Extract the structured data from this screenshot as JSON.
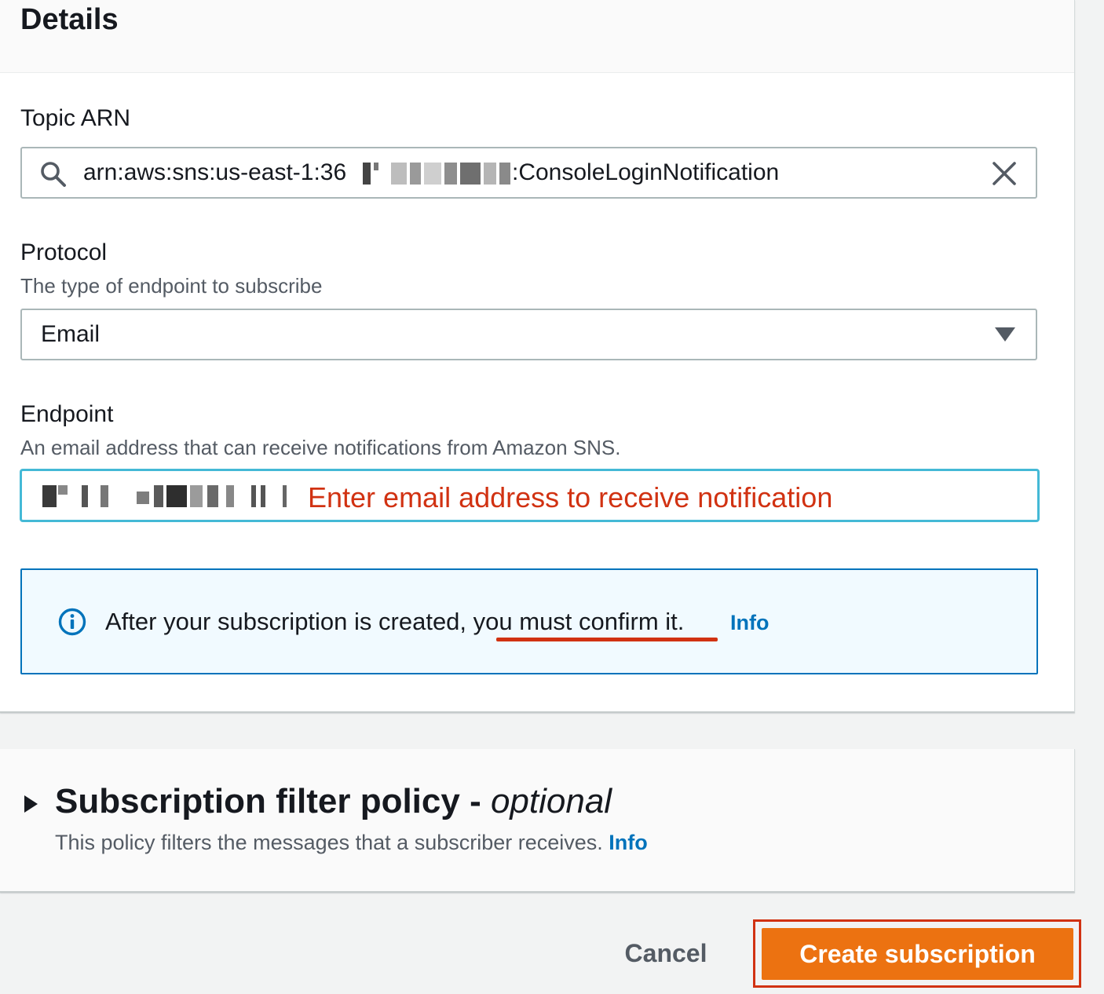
{
  "details": {
    "title": "Details",
    "topic_arn": {
      "label": "Topic ARN",
      "value_prefix": "arn:aws:sns:us-east-1:36",
      "value_suffix": ":ConsoleLoginNotification"
    },
    "protocol": {
      "label": "Protocol",
      "description": "The type of endpoint to subscribe",
      "selected": "Email"
    },
    "endpoint": {
      "label": "Endpoint",
      "description": "An email address that can receive notifications from Amazon SNS.",
      "annotation": "Enter email address to receive notification"
    },
    "alert": {
      "text": "After your subscription is created, you must confirm it.",
      "link": "Info"
    }
  },
  "filter_policy": {
    "title": "Subscription filter policy - ",
    "title_optional": "optional",
    "description": "This policy filters the messages that a subscriber receives.",
    "link": "Info"
  },
  "actions": {
    "cancel": "Cancel",
    "create": "Create subscription"
  },
  "colors": {
    "primary_button": "#ec7211",
    "link": "#0073bb",
    "annotation": "#d13212",
    "alert_bg": "#f1faff",
    "focus": "#44b9d6"
  },
  "icons": {
    "search": "search-icon",
    "clear": "close-icon",
    "dropdown": "caret-down-icon",
    "info": "info-circle-icon",
    "expand": "caret-right-icon"
  }
}
